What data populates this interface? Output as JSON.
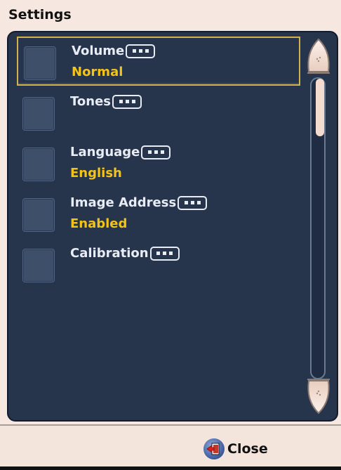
{
  "window": {
    "title": "Settings"
  },
  "settings_list": {
    "items": [
      {
        "label": "Volume",
        "value": "Normal",
        "selected": true
      },
      {
        "label": "Tones",
        "value": ""
      },
      {
        "label": "Language",
        "value": "English"
      },
      {
        "label": "Image Address",
        "value": "Enabled"
      },
      {
        "label": "Calibration",
        "value": ""
      }
    ]
  },
  "footer": {
    "close_label": "Close"
  },
  "colors": {
    "panel_bg": "#26344c",
    "value_text": "#f2c318",
    "selection_border": "#d4b24a",
    "chrome_bg": "#f6e8e0"
  },
  "icons": {
    "more": "ellipsis-icon",
    "scroll_up": "scroll-up-arrow-icon",
    "scroll_down": "scroll-down-arrow-icon",
    "close": "exit-door-icon"
  }
}
